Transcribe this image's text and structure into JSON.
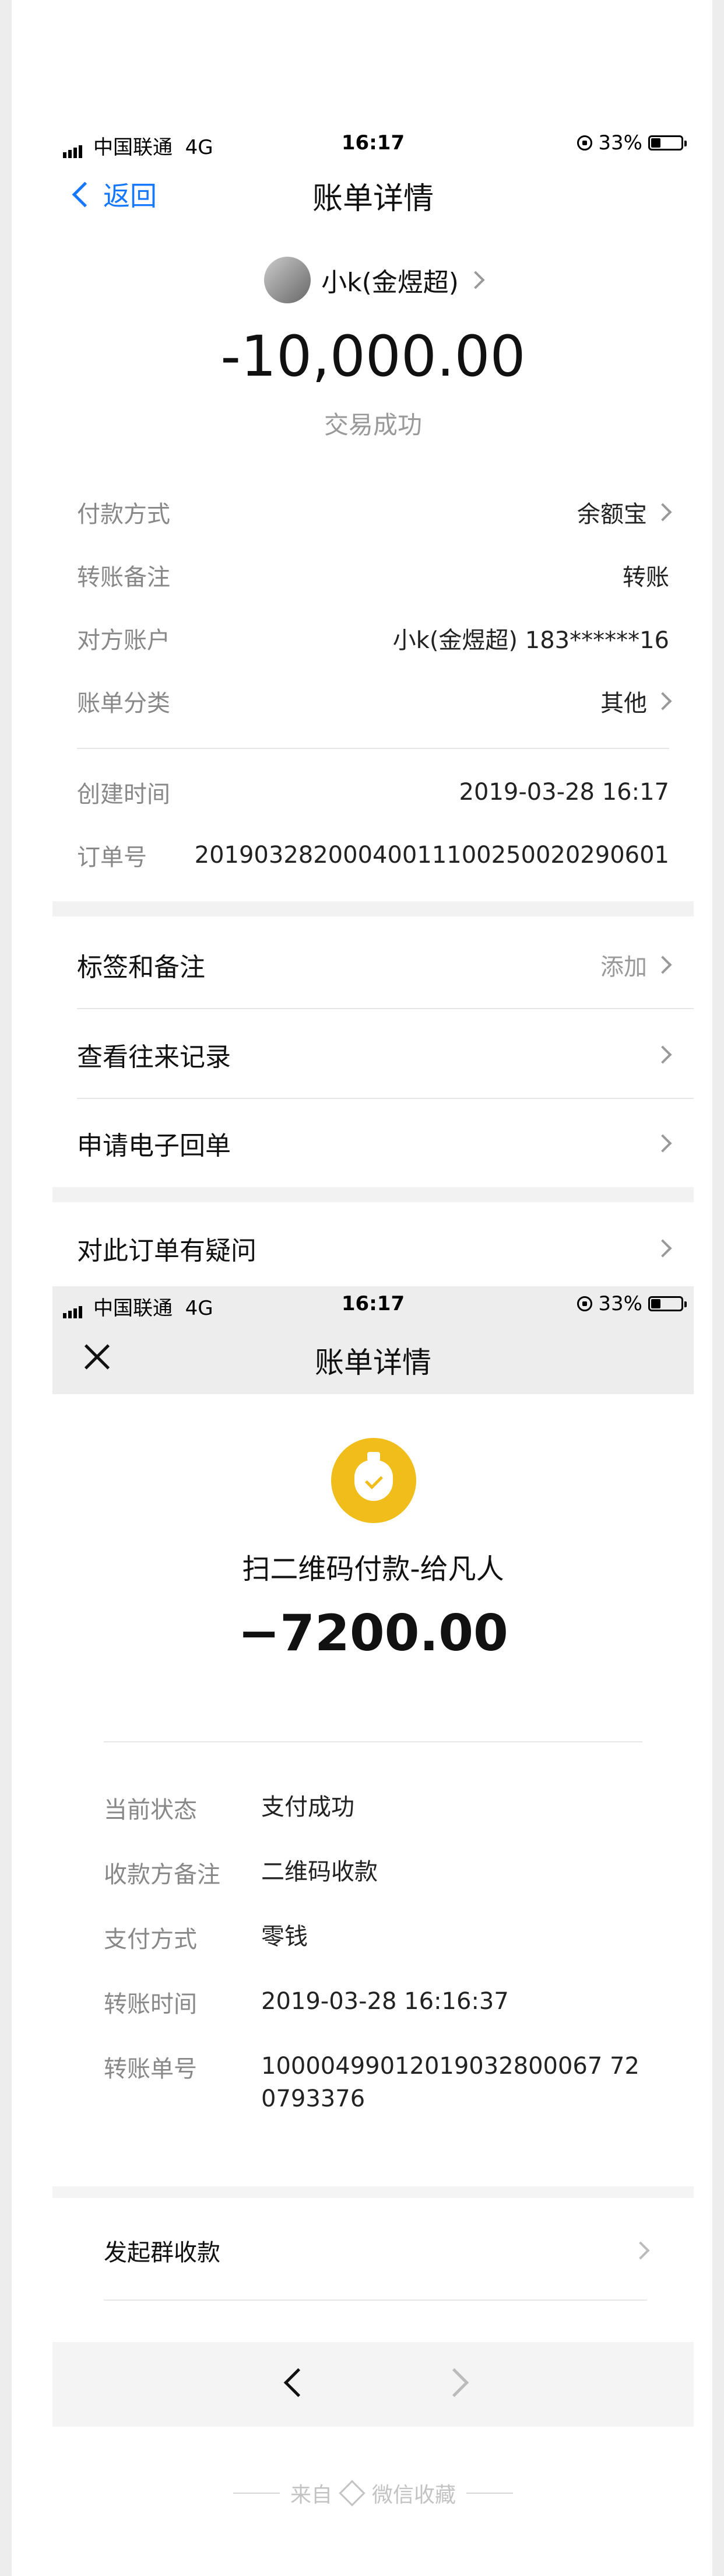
{
  "screen1": {
    "status": {
      "carrier": "中国联通",
      "network": "4G",
      "time": "16:17",
      "battery": "33%",
      "battery_level": 0.33
    },
    "nav": {
      "back_label": "返回",
      "title": "账单详情"
    },
    "counterparty": "小k(金煜超)",
    "amount": "-10,000.00",
    "status_text": "交易成功",
    "details": [
      {
        "label": "付款方式",
        "value": "余额宝",
        "chevron": true
      },
      {
        "label": "转账备注",
        "value": "转账",
        "chevron": false
      },
      {
        "label": "对方账户",
        "value": "小k(金煜超) 183******16",
        "chevron": false
      },
      {
        "label": "账单分类",
        "value": "其他",
        "chevron": true
      }
    ],
    "created": {
      "label": "创建时间",
      "value": "2019-03-28 16:17"
    },
    "order": {
      "label": "订单号",
      "value": "20190328200040011100250020290601"
    },
    "menu": [
      {
        "label": "标签和备注",
        "sub": "添加"
      },
      {
        "label": "查看往来记录",
        "sub": ""
      },
      {
        "label": "申请电子回单",
        "sub": ""
      },
      {
        "label": "对此订单有疑问",
        "sub": ""
      }
    ]
  },
  "screen2": {
    "status": {
      "carrier": "中国联通",
      "network": "4G",
      "time": "16:17",
      "battery": "33%",
      "battery_level": 0.33
    },
    "title": "账单详情",
    "merchant": "扫二维码付款-给凡人",
    "amount": "−7200.00",
    "details": [
      {
        "label": "当前状态",
        "value": "支付成功"
      },
      {
        "label": "收款方备注",
        "value": "二维码收款"
      },
      {
        "label": "支付方式",
        "value": "零钱"
      },
      {
        "label": "转账时间",
        "value": "2019-03-28 16:16:37"
      },
      {
        "label": "转账单号",
        "value": "100004990120190328000677207933 76"
      }
    ],
    "transfer_no_line1": "10000499012019032800067 72",
    "transfer_no_line2": "0793376",
    "menu_item": "发起群收款"
  },
  "footer": {
    "source_prefix": "来自",
    "source_name": "微信收藏"
  },
  "colors": {
    "accent": "#1677ff",
    "coin": "#f0bd1a"
  }
}
